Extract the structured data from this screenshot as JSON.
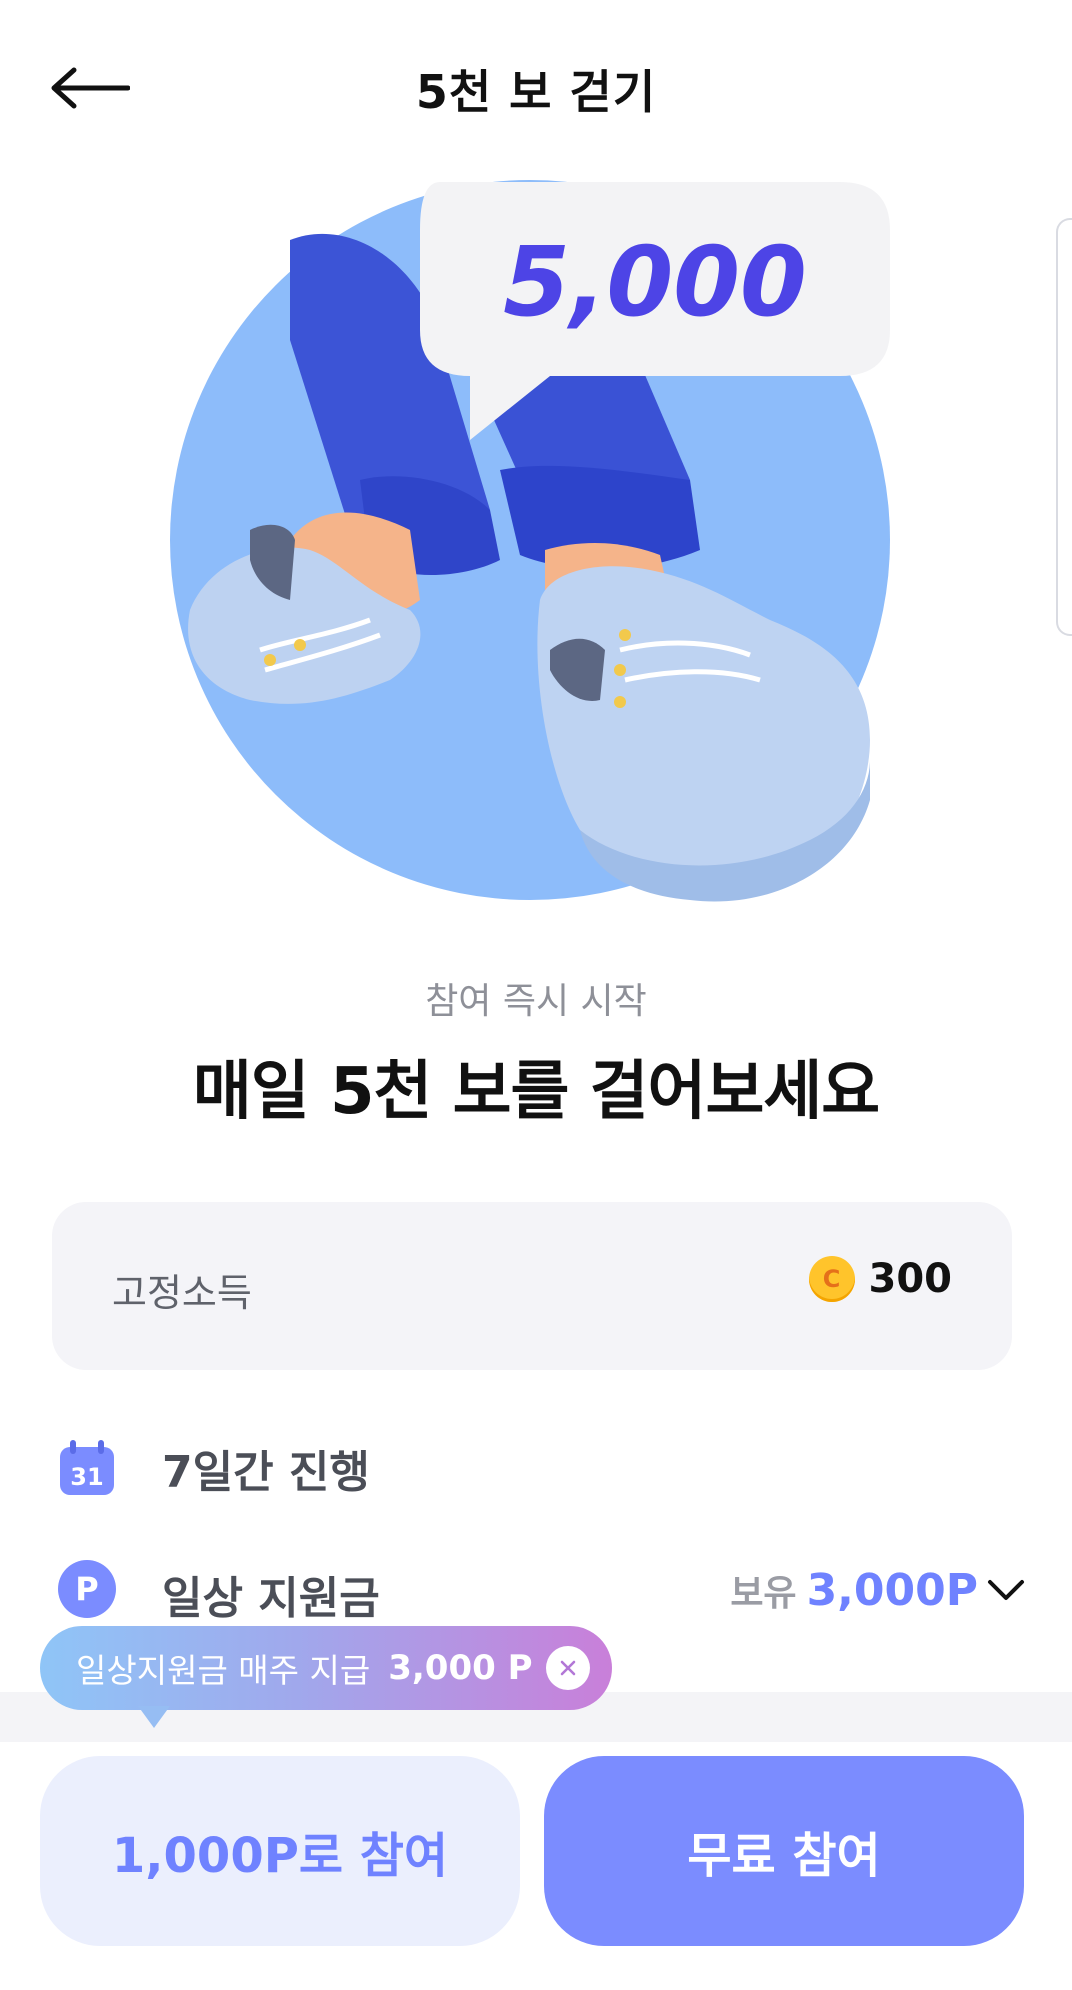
{
  "header": {
    "title": "5천 보 걷기",
    "back_icon": "arrow-left-icon"
  },
  "hero": {
    "bubble_value": "5,000",
    "colors": {
      "circle": "#8dbcfa",
      "pants": "#3f56d8",
      "shoe": "#bcd2f2",
      "bubble_text": "#4d44e6"
    }
  },
  "intro": {
    "subtitle": "참여 즉시 시작",
    "headline": "매일 5천 보를 걸어보세요"
  },
  "income_card": {
    "label": "고정소득",
    "coin_letter": "C",
    "value": "300"
  },
  "details": {
    "duration": {
      "icon": "calendar-icon",
      "calendar_day": "31",
      "text": "7일간 진행"
    },
    "support": {
      "icon_letter": "P",
      "text": "일상 지원금",
      "held_label": "보유",
      "held_value": "3,000P",
      "expand_icon": "chevron-down-icon"
    }
  },
  "tooltip": {
    "text": "일상지원금 매주 지급",
    "amount": "3,000 P",
    "close_icon": "close-icon"
  },
  "actions": {
    "paid_label": "1,000P로 참여",
    "free_label": "무료 참여"
  },
  "colors": {
    "accent": "#7b8cff",
    "accent_light": "#ebeffd",
    "card_bg": "#f4f4f8"
  }
}
